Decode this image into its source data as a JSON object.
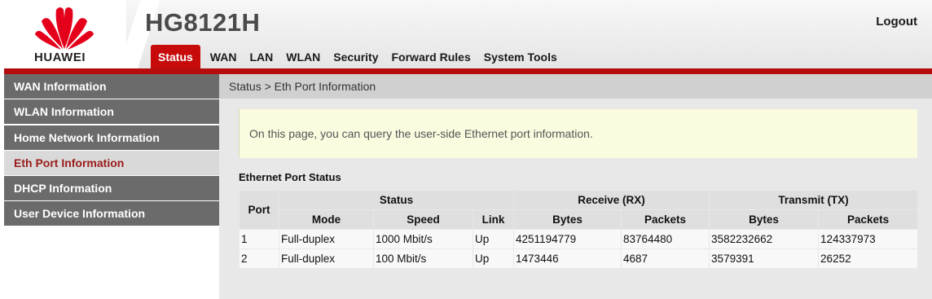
{
  "brand": {
    "logo_text": "HUAWEI",
    "model": "HG8121H",
    "logo_color": "#e4001b"
  },
  "header": {
    "logout_label": "Logout"
  },
  "tabs": [
    {
      "label": "Status",
      "active": true
    },
    {
      "label": "WAN"
    },
    {
      "label": "LAN"
    },
    {
      "label": "WLAN"
    },
    {
      "label": "Security"
    },
    {
      "label": "Forward Rules"
    },
    {
      "label": "System Tools"
    }
  ],
  "sidebar": {
    "items": [
      {
        "label": "WAN Information"
      },
      {
        "label": "WLAN Information"
      },
      {
        "label": "Home Network Information"
      },
      {
        "label": "Eth Port Information",
        "active": true
      },
      {
        "label": "DHCP Information"
      },
      {
        "label": "User Device Information"
      }
    ]
  },
  "breadcrumb": "Status > Eth Port Information",
  "info_text": "On this page, you can query the user-side Ethernet port information.",
  "section_title": "Ethernet Port Status",
  "table": {
    "group_headers": {
      "port": "Port",
      "status": "Status",
      "receive": "Receive (RX)",
      "transmit": "Transmit (TX)"
    },
    "sub_headers": {
      "mode": "Mode",
      "speed": "Speed",
      "link": "Link",
      "rx_bytes": "Bytes",
      "rx_packets": "Packets",
      "tx_bytes": "Bytes",
      "tx_packets": "Packets"
    },
    "rows": [
      {
        "port": "1",
        "mode": "Full-duplex",
        "speed": "1000 Mbit/s",
        "link": "Up",
        "rx_bytes": "4251194779",
        "rx_packets": "83764480",
        "tx_bytes": "3582232662",
        "tx_packets": "124337973"
      },
      {
        "port": "2",
        "mode": "Full-duplex",
        "speed": "100 Mbit/s",
        "link": "Up",
        "rx_bytes": "1473446",
        "rx_packets": "4687",
        "tx_bytes": "3579391",
        "tx_packets": "26252"
      }
    ]
  },
  "colors": {
    "accent_red": "#c70b0b",
    "sidebar_gray": "#6b6b6b",
    "info_bg": "#fbfbe0"
  }
}
